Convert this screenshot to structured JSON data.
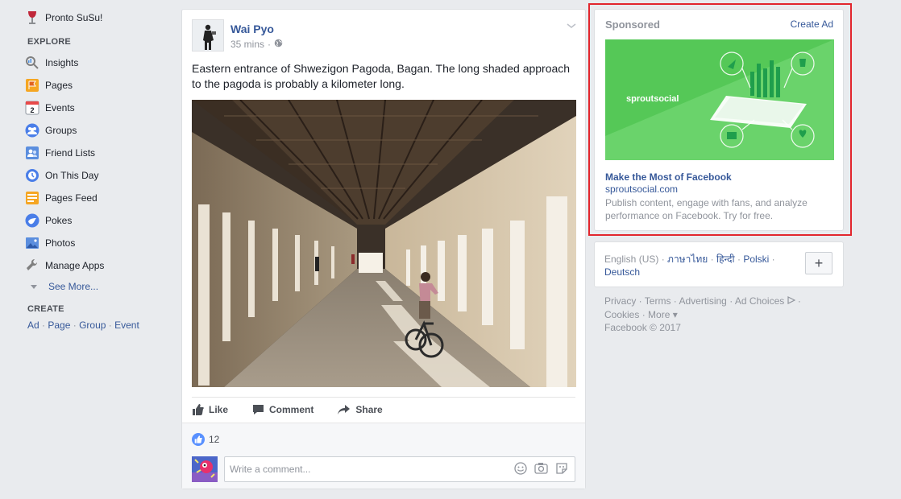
{
  "leftnav": {
    "top_item": "Pronto SuSu!",
    "explore_title": "EXPLORE",
    "items": [
      {
        "label": "Insights",
        "icon": "insights-icon"
      },
      {
        "label": "Pages",
        "icon": "pages-flag-icon"
      },
      {
        "label": "Events",
        "icon": "calendar-icon"
      },
      {
        "label": "Groups",
        "icon": "groups-icon"
      },
      {
        "label": "Friend Lists",
        "icon": "friend-lists-icon"
      },
      {
        "label": "On This Day",
        "icon": "on-this-day-icon"
      },
      {
        "label": "Pages Feed",
        "icon": "pages-feed-icon"
      },
      {
        "label": "Pokes",
        "icon": "poke-icon"
      },
      {
        "label": "Photos",
        "icon": "photos-icon"
      },
      {
        "label": "Manage Apps",
        "icon": "wrench-icon"
      }
    ],
    "events_day": "2",
    "see_more": "See More...",
    "create_title": "CREATE",
    "create_links": [
      "Ad",
      "Page",
      "Group",
      "Event"
    ]
  },
  "post": {
    "author": "Wai Pyo",
    "time": "35 mins",
    "text": "Eastern entrance of Shwezigon Pagoda, Bagan. The long shaded approach to the pagoda is probably a kilometer long.",
    "actions": {
      "like": "Like",
      "comment": "Comment",
      "share": "Share"
    },
    "like_count": "12",
    "comment_placeholder": "Write a comment..."
  },
  "sponsored": {
    "label": "Sponsored",
    "create_ad": "Create Ad",
    "ad_brand": "sproutsocial",
    "ad_title": "Make the Most of Facebook",
    "ad_domain": "sproutsocial.com",
    "ad_description": "Publish content, engage with fans, and analyze performance on Facebook. Try for free."
  },
  "languages": {
    "current": "English (US)",
    "links": [
      "ภาษาไทย",
      "हिन्दी",
      "Polski",
      "Deutsch"
    ],
    "add_label": "+"
  },
  "footer": {
    "links": [
      "Privacy",
      "Terms",
      "Advertising",
      "Ad Choices",
      "Cookies",
      "More"
    ],
    "copyright": "Facebook © 2017"
  },
  "colors": {
    "link": "#365899",
    "page_bg": "#e9ebee",
    "ad_green": "#3ec860",
    "highlight": "#e2262d"
  }
}
